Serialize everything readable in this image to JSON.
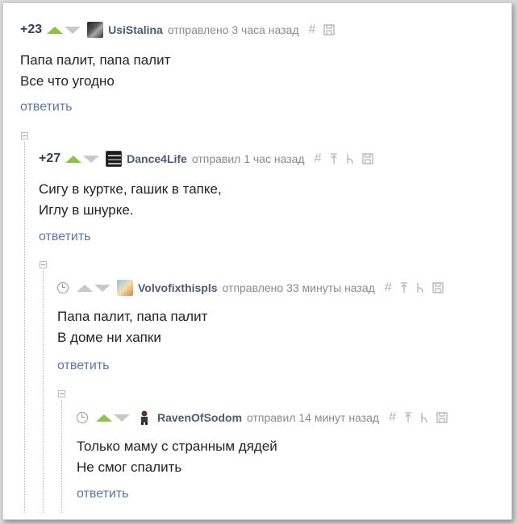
{
  "colors": {
    "accent_link": "#5b77a8",
    "upvote_green": "#8bc34a",
    "username": "#4c5a72"
  },
  "comments": [
    {
      "rating": "+23",
      "username": "UsiStalina",
      "time": "отправлено 3 часа назад",
      "lines": [
        "Папа палит, папа палит",
        "Все что угодно"
      ],
      "reply": "ответить"
    },
    {
      "rating": "+27",
      "username": "Dance4Life",
      "time": "отправил 1 час назад",
      "lines": [
        "Сигу в куртке, гашик в тапке,",
        "Иглу в шнурке."
      ],
      "reply": "ответить"
    },
    {
      "rating": "",
      "username": "Volvofixthispls",
      "time": "отправлено 33 минуты назад",
      "lines": [
        "Папа палит, папа палит",
        "В доме ни хапки"
      ],
      "reply": "ответить"
    },
    {
      "rating": "",
      "username": "RavenOfSodom",
      "time": "отправил 14 минут назад",
      "lines": [
        "Только маму с странным дядей",
        "Не смог спалить"
      ],
      "reply": "ответить"
    }
  ]
}
